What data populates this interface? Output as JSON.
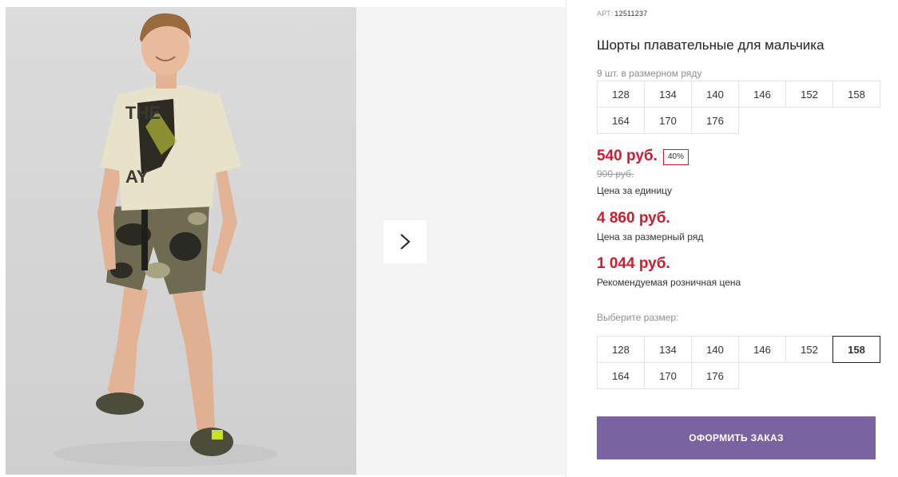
{
  "product": {
    "art_label": "АРТ:",
    "art_number": "12511237",
    "title": "Шорты плавательные для мальчика",
    "pack_hint": "9 шт. в размерном ряду",
    "pack_sizes": [
      "128",
      "134",
      "140",
      "146",
      "152",
      "158",
      "164",
      "170",
      "176"
    ],
    "price": "540 руб.",
    "discount": "40%",
    "old_price": "900 руб.",
    "price_caption": "Цена за единицу",
    "row_price": "4 860 руб.",
    "row_price_caption": "Цена за размерный ряд",
    "retail_price": "1 044 руб.",
    "retail_price_caption": "Рекомендуемая розничная цена",
    "choose_size_hint": "Выберите размер:",
    "sizes": [
      "128",
      "134",
      "140",
      "146",
      "152",
      "158",
      "164",
      "170",
      "176"
    ],
    "selected_size": "158",
    "order_button": "ОФОРМИТЬ ЗАКАЗ"
  },
  "colors": {
    "price": "#d01b2b",
    "order_button": "#7a63a1"
  },
  "icons": {
    "next": "chevron-right-icon"
  }
}
